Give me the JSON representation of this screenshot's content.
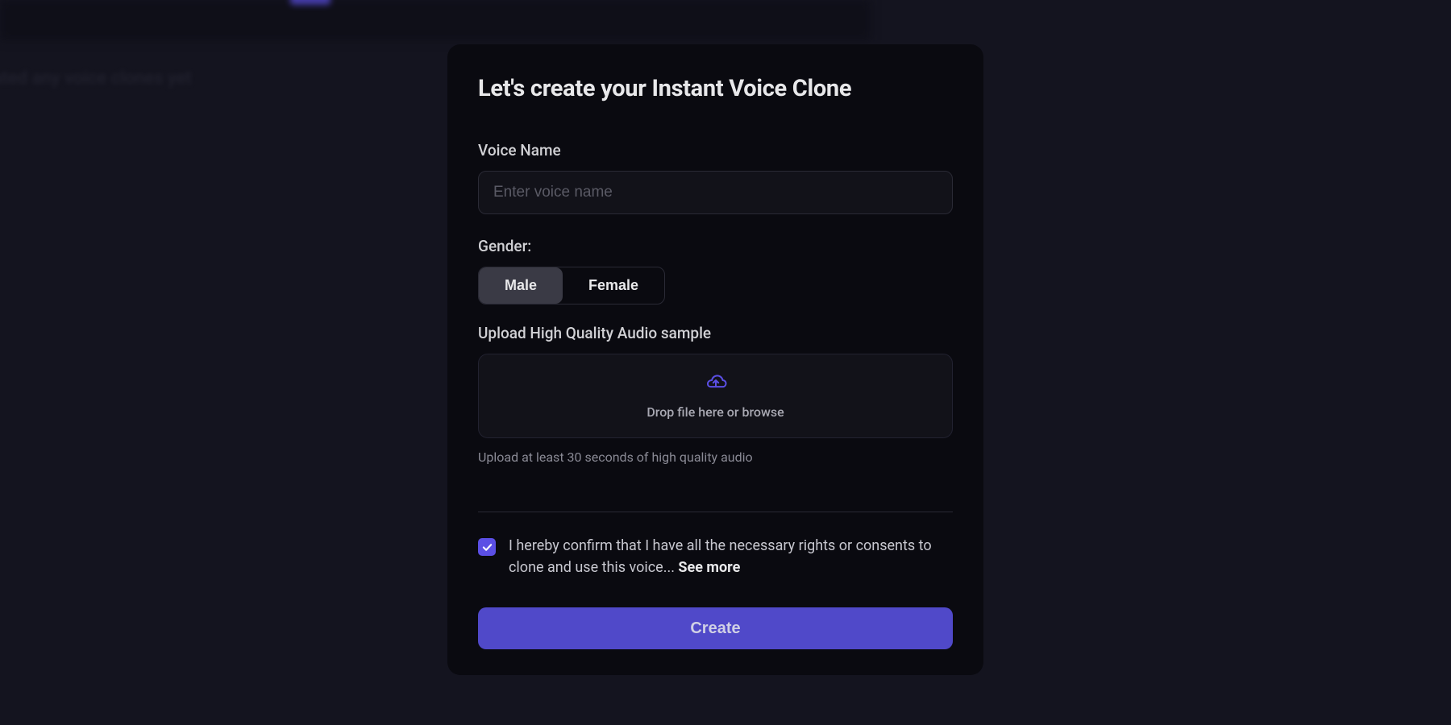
{
  "background": {
    "blurred_text": "created any voice clones yet"
  },
  "modal": {
    "title": "Let's create your Instant Voice Clone",
    "voiceName": {
      "label": "Voice Name",
      "placeholder": "Enter voice name",
      "value": ""
    },
    "gender": {
      "label": "Gender:",
      "options": {
        "male": "Male",
        "female": "Female"
      },
      "selected": "male"
    },
    "upload": {
      "label": "Upload High Quality Audio sample",
      "dropText": "Drop file here or browse",
      "helpText": "Upload at least 30 seconds of high quality audio"
    },
    "consent": {
      "checked": true,
      "text": "I hereby confirm that I have all the necessary rights or consents to clone and use this voice... ",
      "seeMore": "See more"
    },
    "createButton": "Create"
  },
  "colors": {
    "accent": "#5b4fe5",
    "modalBg": "#0a0a10",
    "pageBg": "#14141f"
  }
}
